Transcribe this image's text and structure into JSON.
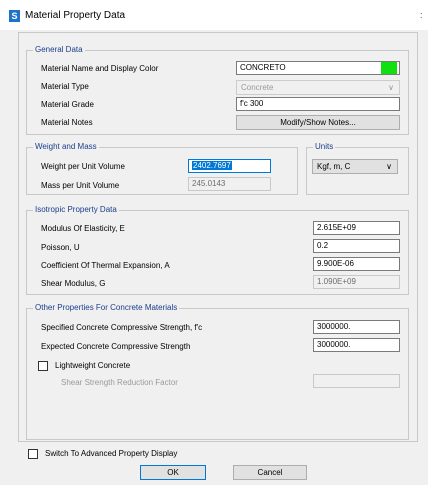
{
  "window": {
    "title": "Material Property Data",
    "app_icon_letter": "S",
    "close_glyph": ":"
  },
  "general": {
    "legend": "General Data",
    "name_label": "Material Name and Display Color",
    "name_value": "CONCRETO",
    "display_color": "#10e010",
    "type_label": "Material Type",
    "type_value": "Concrete",
    "grade_label": "Material Grade",
    "grade_value": "f'c 300",
    "notes_label": "Material Notes",
    "notes_button": "Modify/Show Notes..."
  },
  "weight": {
    "legend": "Weight and Mass",
    "weight_label": "Weight per Unit Volume",
    "weight_value": "2402.7697",
    "mass_label": "Mass per Unit Volume",
    "mass_value": "245.0143"
  },
  "units": {
    "legend": "Units",
    "value": "Kgf, m, C"
  },
  "isotropic": {
    "legend": "Isotropic Property Data",
    "elasticity_label": "Modulus Of Elasticity,  E",
    "elasticity_value": "2.615E+09",
    "poisson_label": "Poisson,  U",
    "poisson_value": "0.2",
    "thermal_label": "Coefficient Of Thermal Expansion,  A",
    "thermal_value": "9.900E-06",
    "shear_label": "Shear Modulus,  G",
    "shear_value": "1.090E+09"
  },
  "concrete": {
    "legend": "Other Properties For Concrete Materials",
    "specified_label": "Specified Concrete Compressive Strength, f'c",
    "specified_value": "3000000.",
    "expected_label": "Expected Concrete Compressive Strength",
    "expected_value": "3000000.",
    "lightweight_label": "Lightweight Concrete",
    "shear_reduction_label": "Shear Strength Reduction Factor",
    "shear_reduction_value": ""
  },
  "footer": {
    "advanced_label": "Switch To Advanced Property Display",
    "ok": "OK",
    "cancel": "Cancel"
  }
}
